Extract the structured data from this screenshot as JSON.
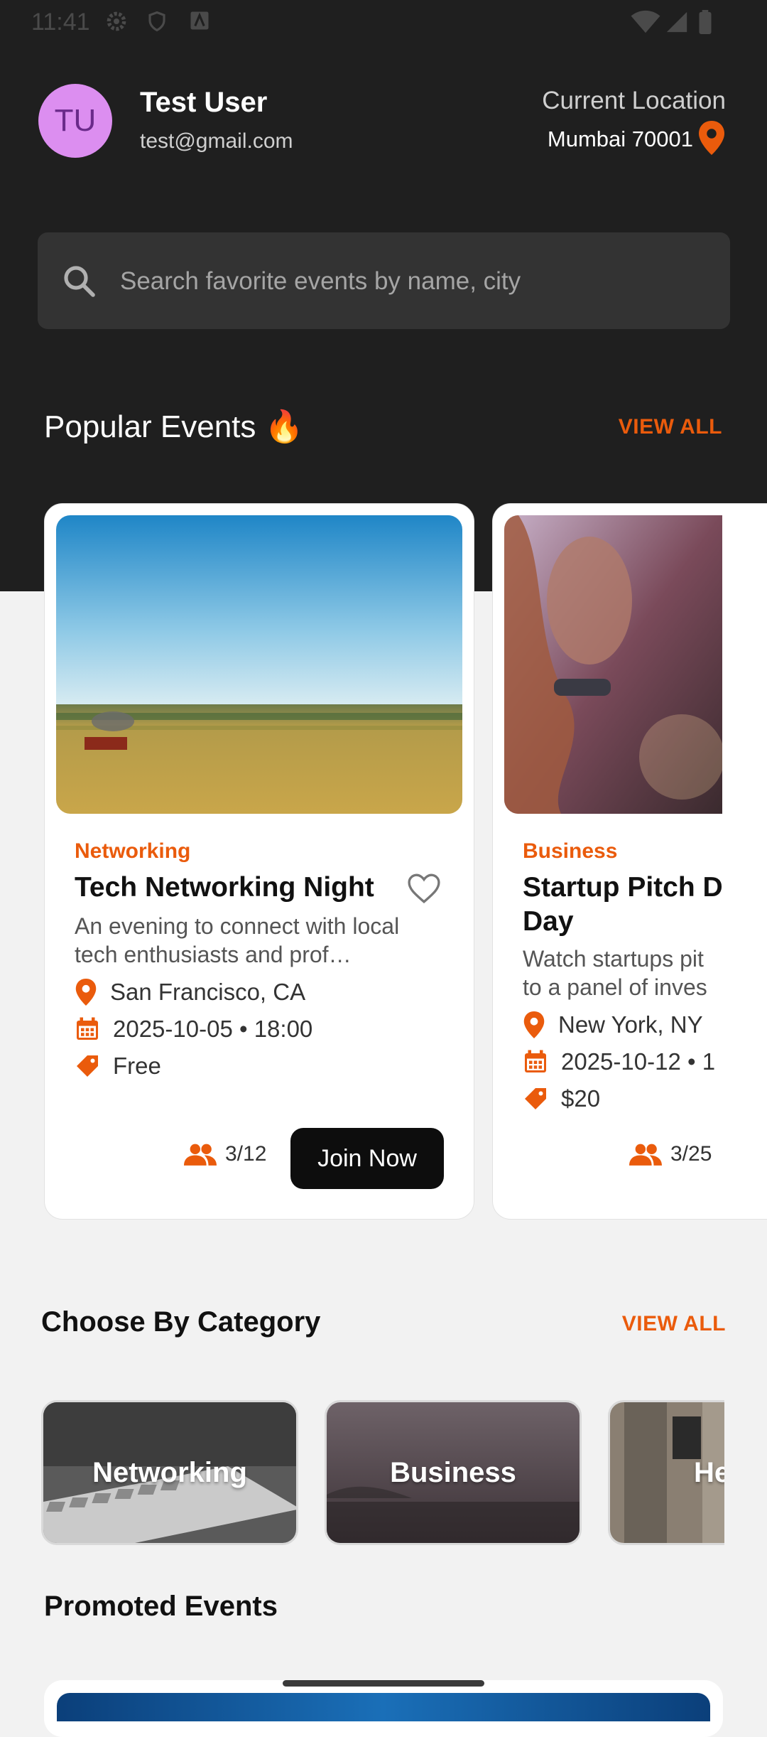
{
  "status_bar": {
    "time": "11:41"
  },
  "header": {
    "avatar_initials": "TU",
    "user_name": "Test User",
    "user_email": "test@gmail.com",
    "location_label": "Current Location",
    "location_value": "Mumbai 70001"
  },
  "search": {
    "placeholder": "Search favorite events by name, city"
  },
  "popular": {
    "title": "Popular Events 🔥",
    "view_all": "VIEW ALL",
    "events": [
      {
        "category": "Networking",
        "title": "Tech Networking Night",
        "description": "An evening to connect with local tech enthusiasts and prof…",
        "location": "San Francisco, CA",
        "datetime": "2025-10-05 • 18:00",
        "price": "Free",
        "attendees": "3/12",
        "join_label": "Join Now"
      },
      {
        "category": "Business",
        "title": "Startup Pitch D Day",
        "title_line1": "Startup Pitch D",
        "title_line2": "Day",
        "description_line1": "Watch startups pit",
        "description_line2": "to a panel of inves",
        "location": "New York, NY",
        "datetime": "2025-10-12 • 1",
        "price": "$20",
        "attendees": "3/25"
      }
    ]
  },
  "categories": {
    "title": "Choose By Category",
    "view_all": "VIEW ALL",
    "items": [
      {
        "label": "Networking"
      },
      {
        "label": "Business"
      },
      {
        "label": "He"
      }
    ]
  },
  "promoted": {
    "title": "Promoted Events"
  },
  "colors": {
    "accent": "#ea5b0c",
    "dark_bg": "#1f1f1f",
    "avatar_bg": "#dc8ef0"
  }
}
